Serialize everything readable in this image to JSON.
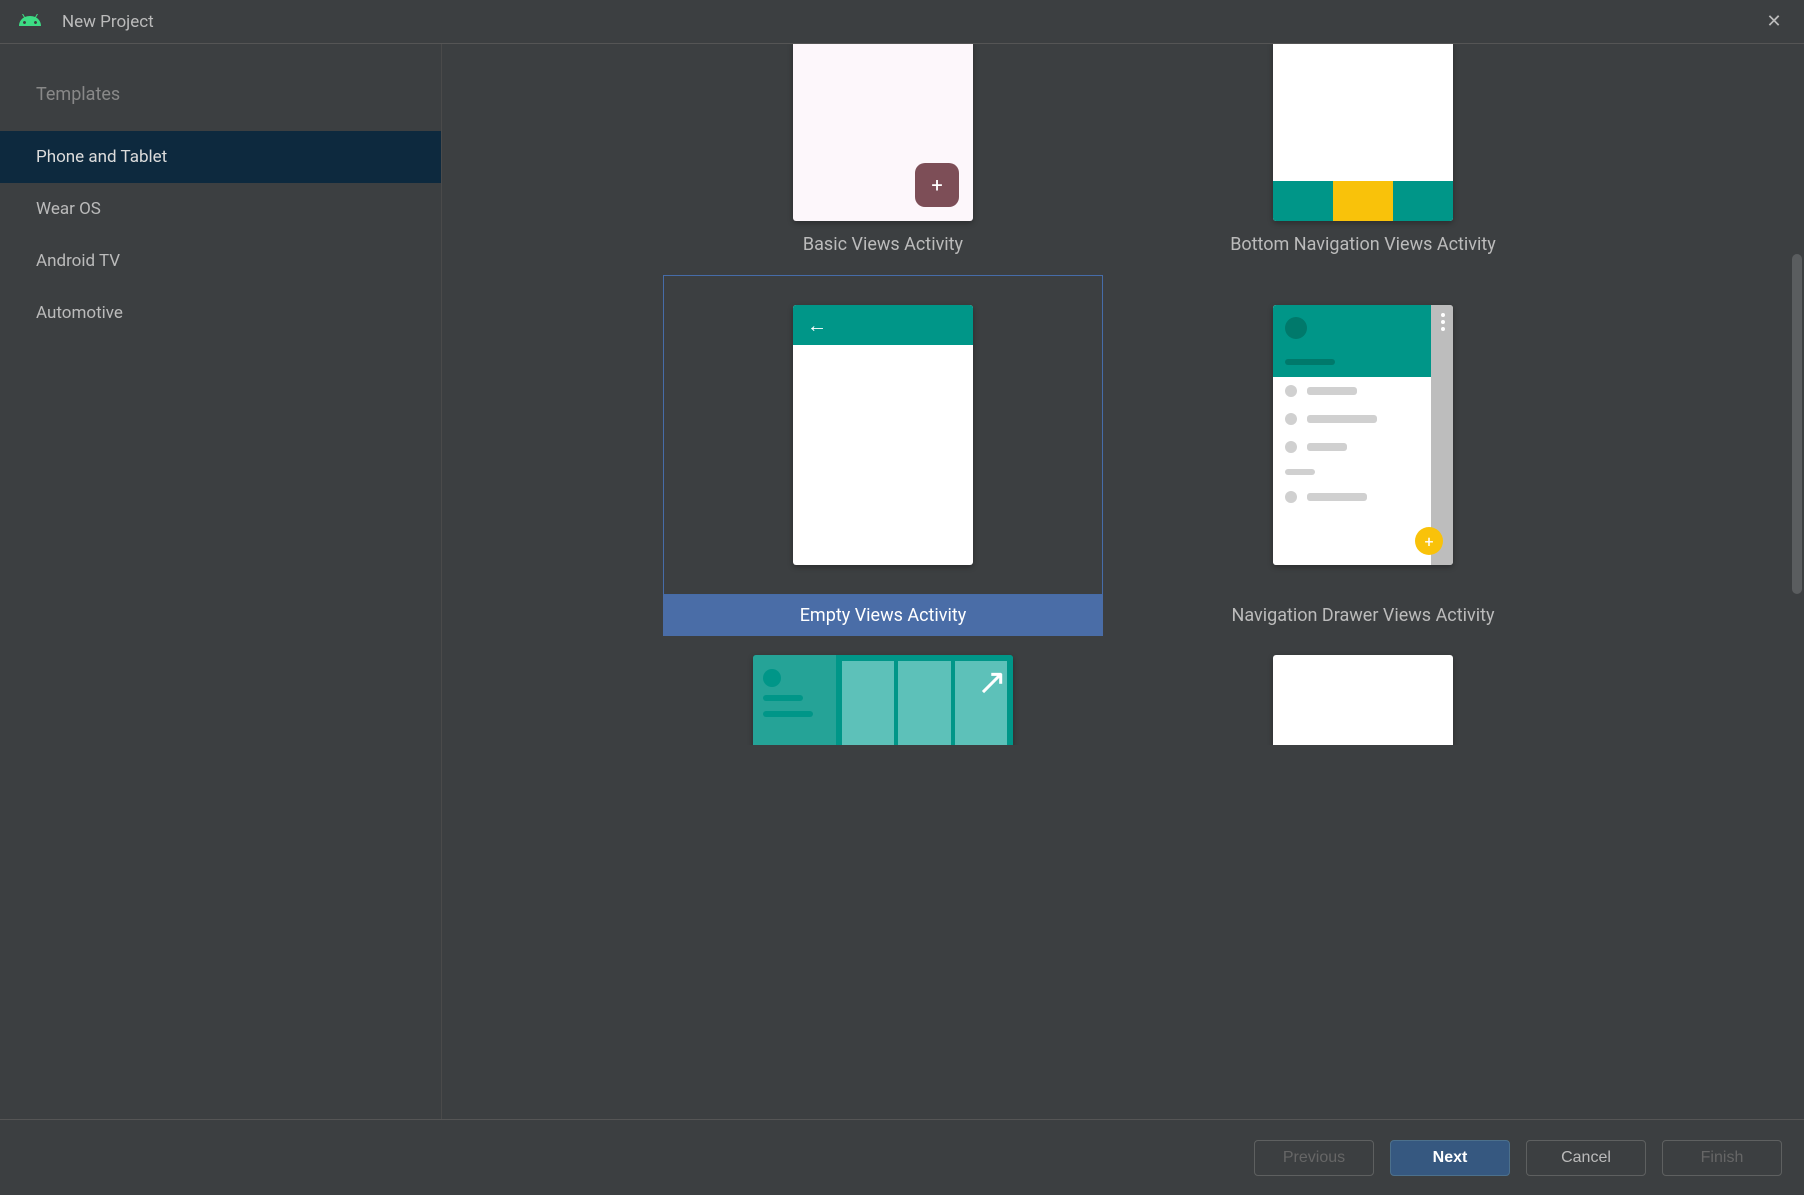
{
  "window": {
    "title": "New Project"
  },
  "sidebar": {
    "header": "Templates",
    "items": [
      {
        "label": "Phone and Tablet",
        "selected": true
      },
      {
        "label": "Wear OS",
        "selected": false
      },
      {
        "label": "Android TV",
        "selected": false
      },
      {
        "label": "Automotive",
        "selected": false
      }
    ]
  },
  "templates": [
    {
      "label": "Basic Views Activity",
      "selected": false,
      "kind": "basic",
      "partial": "top"
    },
    {
      "label": "Bottom Navigation Views Activity",
      "selected": false,
      "kind": "bottomnav",
      "partial": "top"
    },
    {
      "label": "Empty Views Activity",
      "selected": true,
      "kind": "empty",
      "partial": null
    },
    {
      "label": "Navigation Drawer Views Activity",
      "selected": false,
      "kind": "drawer",
      "partial": null
    },
    {
      "label": "",
      "selected": false,
      "kind": "fullscreen",
      "partial": "bottom"
    },
    {
      "label": "",
      "selected": false,
      "kind": "game",
      "partial": "bottom"
    }
  ],
  "footer": {
    "previous": "Previous",
    "next": "Next",
    "cancel": "Cancel",
    "finish": "Finish"
  }
}
